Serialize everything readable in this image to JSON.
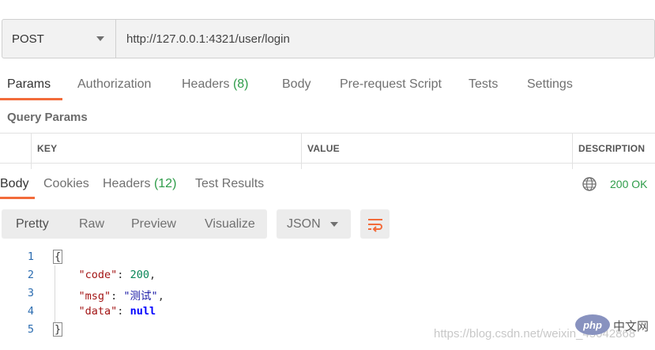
{
  "request": {
    "method": "POST",
    "url": "http://127.0.0.1:4321/user/login"
  },
  "request_tabs": [
    {
      "label": "Params",
      "count": "",
      "active": true
    },
    {
      "label": "Authorization",
      "count": ""
    },
    {
      "label": "Headers",
      "count": "(8)"
    },
    {
      "label": "Body",
      "count": ""
    },
    {
      "label": "Pre-request Script",
      "count": ""
    },
    {
      "label": "Tests",
      "count": ""
    },
    {
      "label": "Settings",
      "count": ""
    }
  ],
  "query_params": {
    "title": "Query Params",
    "columns": [
      "KEY",
      "VALUE",
      "DESCRIPTION"
    ]
  },
  "response_tabs": [
    {
      "label": "Body",
      "count": "",
      "active": true
    },
    {
      "label": "Cookies",
      "count": ""
    },
    {
      "label": "Headers",
      "count": "(12)"
    },
    {
      "label": "Test Results",
      "count": ""
    }
  ],
  "response": {
    "status": "200 OK",
    "globe_icon": "globe-icon"
  },
  "view_modes": [
    "Pretty",
    "Raw",
    "Preview",
    "Visualize"
  ],
  "format": "JSON",
  "wrap_icon": "wrap-lines-icon",
  "code_lines": [
    {
      "n": "1",
      "open": "{"
    },
    {
      "n": "2",
      "key": "\"code\"",
      "sep": ": ",
      "value": "200",
      "end": ","
    },
    {
      "n": "3",
      "key": "\"msg\"",
      "sep": ": ",
      "value": "\"测试\"",
      "end": ","
    },
    {
      "n": "4",
      "key": "\"data\"",
      "sep": ": ",
      "value": "null",
      "end": ""
    },
    {
      "n": "5",
      "close": "}"
    }
  ],
  "watermark": "https://blog.csdn.net/weixin_45042868",
  "php_logo": {
    "text": "php",
    "caption": "中文网"
  },
  "colors": {
    "accent": "#f26b3a",
    "success": "#2e9c49"
  }
}
